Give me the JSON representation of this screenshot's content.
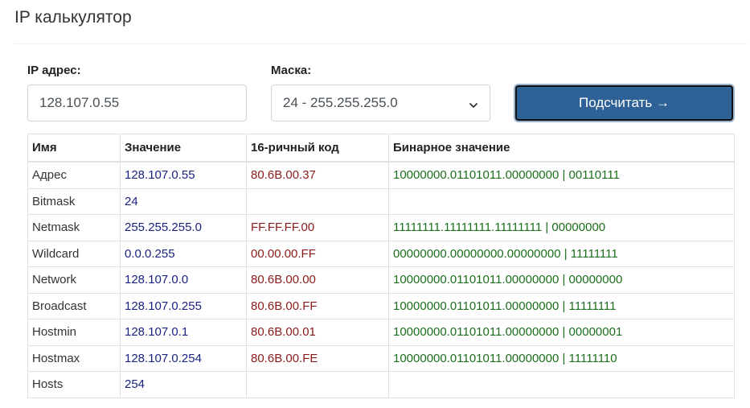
{
  "page": {
    "title": "IP калькулятор"
  },
  "form": {
    "ip_label": "IP адрес:",
    "ip_value": "128.107.0.55",
    "mask_label": "Маска:",
    "mask_selected": "24 - 255.255.255.0",
    "button_label": "Подсчитать →"
  },
  "table": {
    "headers": [
      "Имя",
      "Значение",
      "16-ричный код",
      "Бинарное значение"
    ],
    "rows": [
      {
        "name": "Адрес",
        "value": "128.107.0.55",
        "hex": "80.6B.00.37",
        "bin": "10000000.01101011.00000000 | 00110111"
      },
      {
        "name": "Bitmask",
        "value": "24",
        "hex": "",
        "bin": ""
      },
      {
        "name": "Netmask",
        "value": "255.255.255.0",
        "hex": "FF.FF.FF.00",
        "bin": "11111111.11111111.11111111 | 00000000"
      },
      {
        "name": "Wildcard",
        "value": "0.0.0.255",
        "hex": "00.00.00.FF",
        "bin": "00000000.00000000.00000000 | 11111111"
      },
      {
        "name": "Network",
        "value": "128.107.0.0",
        "hex": "80.6B.00.00",
        "bin": "10000000.01101011.00000000 | 00000000"
      },
      {
        "name": "Broadcast",
        "value": "128.107.0.255",
        "hex": "80.6B.00.FF",
        "bin": "10000000.01101011.00000000 | 11111111"
      },
      {
        "name": "Hostmin",
        "value": "128.107.0.1",
        "hex": "80.6B.00.01",
        "bin": "10000000.01101011.00000000 | 00000001"
      },
      {
        "name": "Hostmax",
        "value": "128.107.0.254",
        "hex": "80.6B.00.FE",
        "bin": "10000000.01101011.00000000 | 11111110"
      },
      {
        "name": "Hosts",
        "value": "254",
        "hex": "",
        "bin": ""
      }
    ]
  },
  "icons": {
    "select_arrow": "chevron-down-icon"
  },
  "colors": {
    "button_bg": "#2e6196",
    "value_color": "#1a237e",
    "hex_color": "#8b1a1a",
    "bin_color": "#1b6e1b"
  }
}
